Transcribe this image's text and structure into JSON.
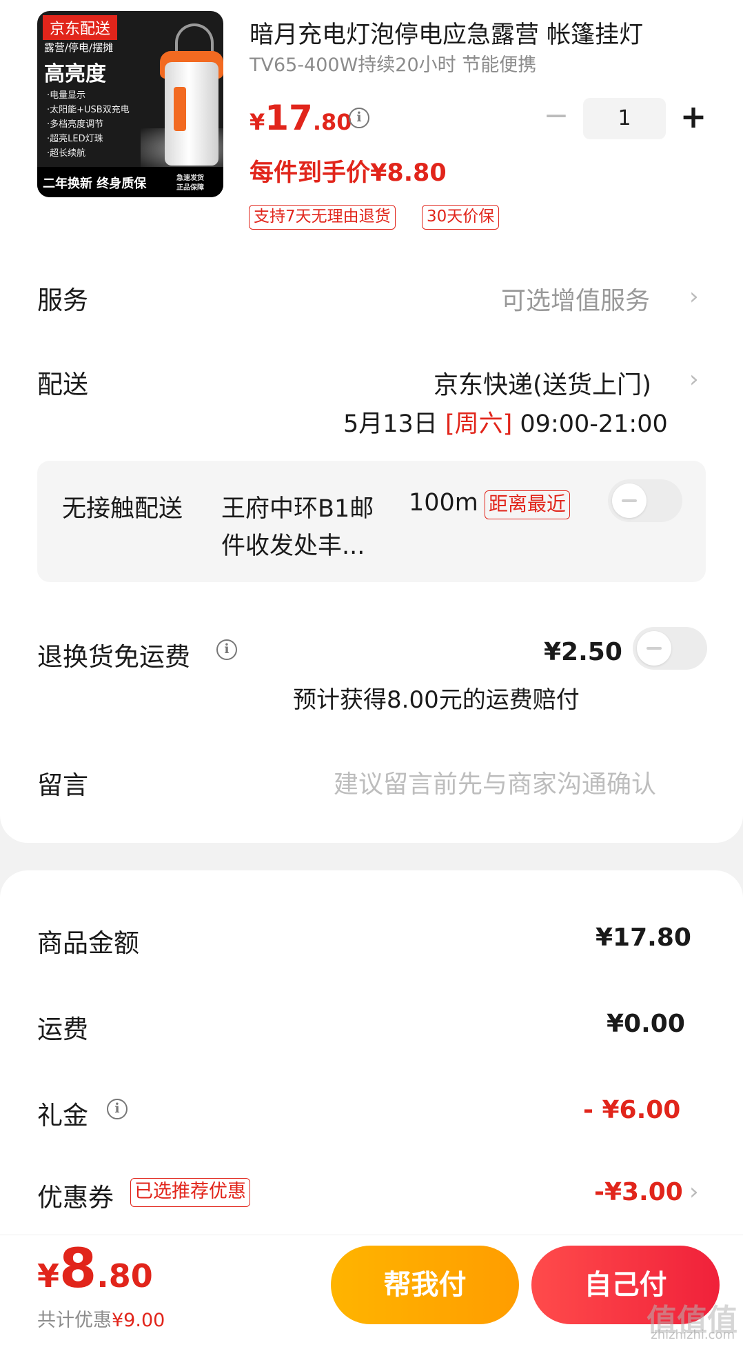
{
  "product": {
    "thumb_tag": "京东配送",
    "thumb_sub": "露营/停电/摆摊",
    "thumb_big": "高亮度",
    "thumb_features": [
      "·电量显示",
      "·太阳能+USB双充电",
      "·多档亮度调节",
      "·超亮LED灯珠",
      "·超长续航"
    ],
    "thumb_bottom": "二年换新 终身质保",
    "thumb_bottom_small_1": "急速发货",
    "thumb_bottom_small_2": "正品保障",
    "title": "暗月充电灯泡停电应急露营 帐篷挂灯",
    "subtitle": "TV65-400W持续20小时 节能便携",
    "price_currency": "¥",
    "price_int": "17",
    "price_dec": ".80",
    "each_price": "每件到手价¥8.80",
    "tags": [
      "支持7天无理由退货",
      "30天价保"
    ],
    "quantity": "1",
    "minus": "−",
    "plus": "+"
  },
  "service": {
    "label": "服务",
    "value": "可选增值服务"
  },
  "delivery": {
    "label": "配送",
    "method": "京东快递(送货上门)",
    "date": "5月13日",
    "weekday": "[周六]",
    "time": "09:00-21:00"
  },
  "contactless": {
    "label": "无接触配送",
    "location_line1": "王府中环B1邮",
    "location_line2": "件收发处丰...",
    "distance": "100m",
    "badge": "距离最近",
    "enabled": false
  },
  "return_insurance": {
    "label": "退换货免运费",
    "price": "¥2.50",
    "note": "预计获得8.00元的运费赔付",
    "enabled": false
  },
  "message": {
    "label": "留言",
    "placeholder": "建议留言前先与商家沟通确认"
  },
  "summary": {
    "goods_label": "商品金额",
    "goods_value": "¥17.80",
    "shipping_label": "运费",
    "shipping_value": "¥0.00",
    "gift_label": "礼金",
    "gift_value": "- ¥6.00",
    "coupon_label": "优惠券",
    "coupon_badge": "已选推荐优惠",
    "coupon_value": "-¥3.00"
  },
  "footer": {
    "total_currency": "¥",
    "total_int": "8",
    "total_dec": ".80",
    "save_prefix": "共计优惠",
    "save_value": "¥9.00",
    "help_pay": "帮我付",
    "self_pay": "自己付"
  },
  "watermark": {
    "text": "值值值",
    "url": "zhizhizhi.com"
  },
  "colors": {
    "accent": "#e1251b",
    "help_button": "#ffa800",
    "self_button": "#f0213a"
  }
}
